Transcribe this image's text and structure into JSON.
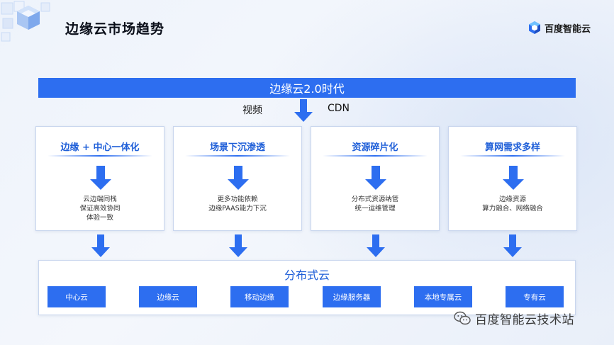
{
  "header": {
    "title": "边缘云市场趋势",
    "brand_name": "百度智能云"
  },
  "era_bar": {
    "label": "边缘云2.0时代"
  },
  "drivers": {
    "left": "视频",
    "right": "CDN"
  },
  "cards": [
    {
      "title": "边缘 + 中心一体化",
      "lines": [
        "云边端同栈",
        "保证高效协同",
        "体验一致"
      ]
    },
    {
      "title": "场景下沉渗透",
      "lines": [
        "更多功能依赖",
        "边缘PAAS能力下沉"
      ]
    },
    {
      "title": "资源碎片化",
      "lines": [
        "分布式资源纳管",
        "统一运维管理"
      ]
    },
    {
      "title": "算网需求多样",
      "lines": [
        "边缘资源",
        "算力融合、网络融合"
      ]
    }
  ],
  "distributed_cloud": {
    "title": "分布式云",
    "items": [
      "中心云",
      "边缘云",
      "移动边缘",
      "边缘服务器",
      "本地专属云",
      "专有云"
    ]
  },
  "watermark": {
    "text": "百度智能云技术站"
  },
  "colors": {
    "accent": "#2d6ef0",
    "accent_text": "#1f5fd8"
  }
}
